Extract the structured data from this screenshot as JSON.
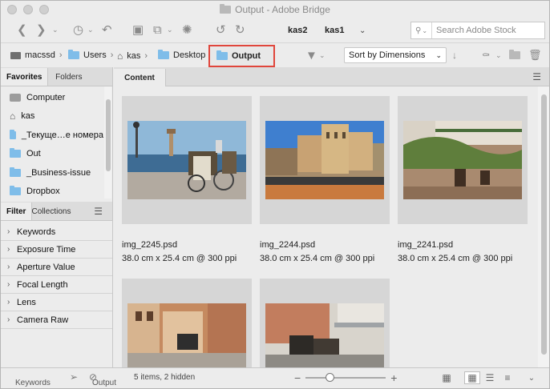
{
  "window": {
    "title": "Output - Adobe Bridge"
  },
  "toolbar": {
    "workspace_tabs": [
      "kas2",
      "kas1"
    ],
    "search_placeholder": "Search Adobe Stock"
  },
  "pathbar": {
    "crumbs": [
      "macssd",
      "Users",
      "kas",
      "Desktop"
    ],
    "current": "Output",
    "sort_label": "Sort by Dimensions"
  },
  "left": {
    "top_tabs": [
      "Favorites",
      "Folders"
    ],
    "favorites": [
      "Computer",
      "kas",
      "_Текуще…е номера",
      "Out",
      "_Business-issue",
      "Dropbox"
    ],
    "bottom_tabs": [
      "Filter",
      "Collections"
    ],
    "filters": [
      "Keywords",
      "Exposure Time",
      "Aperture Value",
      "Focal Length",
      "Lens",
      "Camera Raw"
    ]
  },
  "content": {
    "tab": "Content",
    "items": [
      {
        "name": "img_2245.psd",
        "meta": "38.0 cm x 25.4 cm @ 300 ppi"
      },
      {
        "name": "img_2244.psd",
        "meta": "38.0 cm x 25.4 cm @ 300 ppi"
      },
      {
        "name": "img_2241.psd",
        "meta": "38.0 cm x 25.4 cm @ 300 ppi"
      },
      {
        "name": "",
        "meta": ""
      },
      {
        "name": "",
        "meta": ""
      }
    ],
    "status": "5 items, 2 hidden",
    "zoom_level": 0.3
  },
  "bottom_tabs": [
    "Keywords",
    "Output"
  ],
  "colors": {
    "highlight_border": "#e0463c",
    "folder_blue": "#7fbde9"
  }
}
